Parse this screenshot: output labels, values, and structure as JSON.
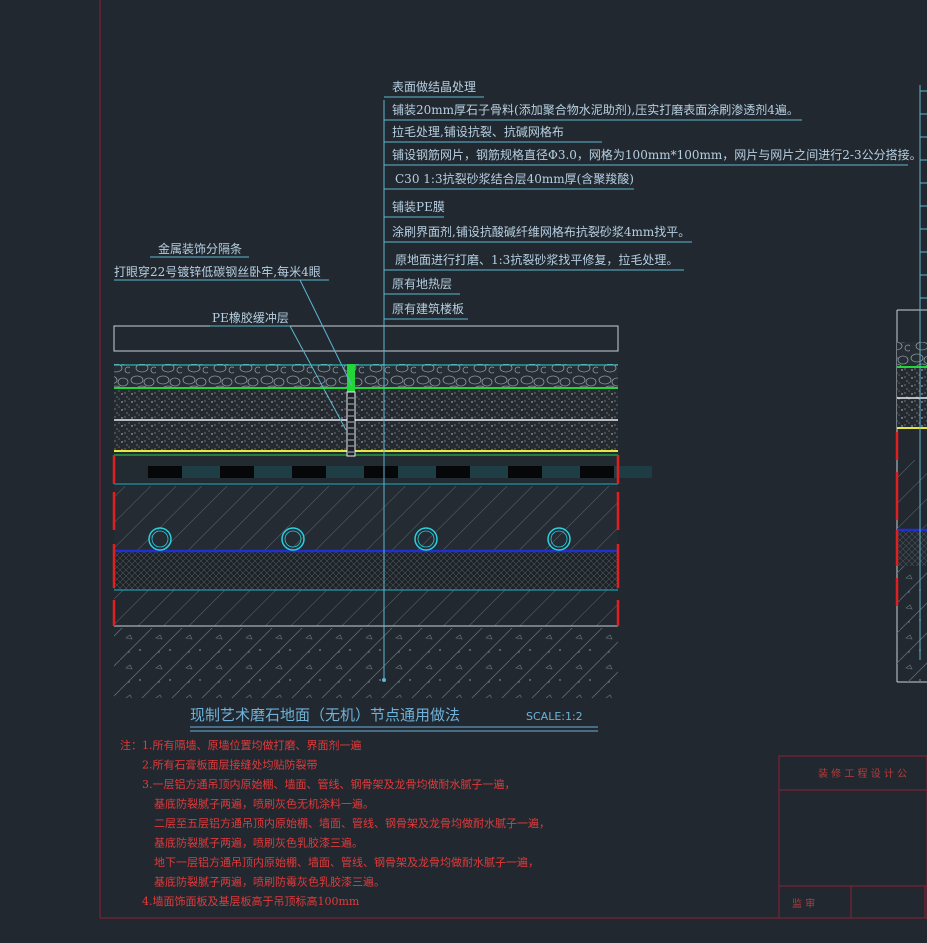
{
  "layers": [
    "表面做结晶处理",
    "铺装20mm厚石子骨料(添加聚合物水泥助剂),压实打磨表面涂刷渗透剂4遍。",
    "拉毛处理,铺设抗裂、抗碱网格布",
    "铺设钢筋网片，钢筋规格直径Φ3.0，网格为100mm*100mm，网片与网片之间进行2-3公分搭接。",
    "C30 1:3抗裂砂浆结合层40mm厚(含聚羧酸)",
    "铺装PE膜",
    "涂刷界面剂,铺设抗酸碱纤维网格布抗裂砂浆4mm找平。",
    "原地面进行打磨、1:3抗裂砂浆找平修复，拉毛处理。",
    "原有地热层",
    "原有建筑楼板"
  ],
  "left_labels": {
    "strip": "金属装饰分隔条",
    "strip_fix": "打眼穿22号镀锌低碳钢丝卧牢,每米4眼",
    "pe_buffer": "PE橡胶缓冲层"
  },
  "caption": {
    "title": "现制艺术磨石地面（无机）节点通用做法",
    "scale": "SCALE:1:2"
  },
  "notes": [
    "注：1.所有隔墙、原墙位置均做打磨、界面剂一遍",
    "2.所有石膏板面层接缝处均贴防裂带",
    "3.一层铝方通吊顶内原始棚、墙面、管线、钢骨架及龙骨均做耐水腻子一遍，",
    "基底防裂腻子两遍，喷刷灰色无机涂料一遍。",
    "二层至五层铝方通吊顶内原始棚、墙面、管线、钢骨架及龙骨均做耐水腻子一遍，",
    "基底防裂腻子两遍，喷刷灰色乳胶漆三遍。",
    "地下一层铝方通吊顶内原始棚、墙面、管线、钢骨架及龙骨均做耐水腻子一遍，",
    "基底防裂腻子两遍，喷刷防霉灰色乳胶漆三遍。",
    "4.墙面饰面板及基层板高于吊顶标高100mm"
  ],
  "title_block": {
    "header": "装 修 工 程 设 计 公",
    "footer": "监  审"
  },
  "colors": {
    "background": "#212830",
    "frame": "#8a1f35",
    "label": "#b6cfe0",
    "leader": "#5fb6cf",
    "note": "#e23a3a",
    "green_line": "#22d63a",
    "yellow_line": "#e6e642",
    "blue_line": "#1f2fd0",
    "red_boundary": "#e02020",
    "pipe": "#2ad0e0"
  }
}
